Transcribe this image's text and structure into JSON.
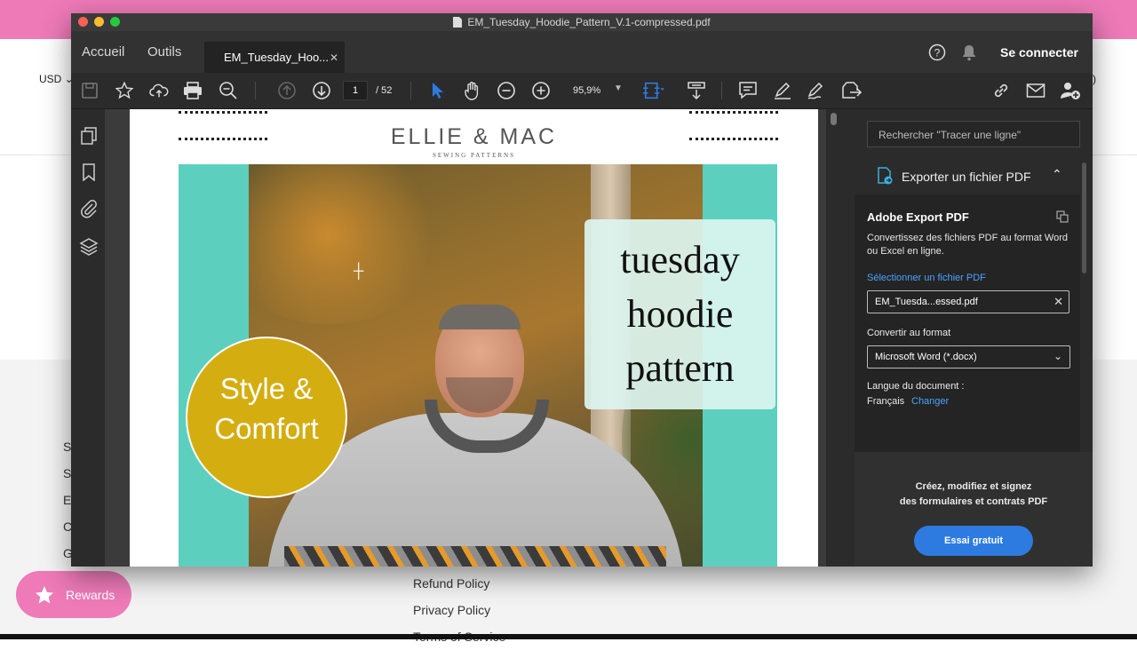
{
  "background": {
    "currency": "USD",
    "footer_links": [
      "Refund Policy",
      "Privacy Policy",
      "Terms of Service"
    ],
    "footer_letters": [
      "S",
      "S",
      "E",
      "C",
      "G"
    ],
    "header_right_fragment": ")",
    "rewards_label": "Rewards"
  },
  "window": {
    "title": "EM_Tuesday_Hoodie_Pattern_V.1-compressed.pdf",
    "tabs": {
      "home": "Accueil",
      "tools": "Outils",
      "doc": "EM_Tuesday_Hoo..."
    },
    "sign_in": "Se connecter"
  },
  "toolbar": {
    "page_current": "1",
    "page_total": "/ 52",
    "zoom": "95,9%"
  },
  "document": {
    "brand": "ELLIE & MAC",
    "brand_sub": "SEWING PATTERNS",
    "title_lines": [
      "tuesday",
      "hoodie",
      "pattern"
    ],
    "badge_lines": [
      "Style &",
      "Comfort"
    ]
  },
  "right_panel": {
    "search_placeholder": "Rechercher \"Tracer une ligne\"",
    "section_title": "Exporter un fichier PDF",
    "export_title": "Adobe Export PDF",
    "export_desc": "Convertissez des fichiers PDF au format Word ou Excel en ligne.",
    "select_file_link": "Sélectionner un fichier PDF",
    "file_name": "EM_Tuesda...essed.pdf",
    "convert_label": "Convertir au format",
    "format_value": "Microsoft Word (*.docx)",
    "lang_label": "Langue du document :",
    "lang_value": "Français",
    "lang_change": "Changer",
    "promo_line1": "Créez, modifiez et signez",
    "promo_line2": "des formulaires et contrats PDF",
    "trial_button": "Essai gratuit"
  },
  "colors": {
    "pink": "#ee7ab8",
    "accent_blue": "#2d7be0",
    "link_blue": "#4aa3ff",
    "teal": "#5ccfbf",
    "mustard": "#d4ad10"
  },
  "icons": [
    "save-icon",
    "star-icon",
    "cloud-upload-icon",
    "print-icon",
    "zoom-search-icon",
    "arrow-up-icon",
    "arrow-down-icon",
    "pointer-icon",
    "hand-icon",
    "minus-circle-icon",
    "plus-circle-icon",
    "fit-icon",
    "scroll-icon",
    "comment-icon",
    "highlight-icon",
    "sign-icon",
    "share-icon",
    "link-icon",
    "mail-icon",
    "add-user-icon",
    "help-icon",
    "bell-icon",
    "pages-icon",
    "bookmark-icon",
    "attachment-icon",
    "layers-icon",
    "export-pdf-icon",
    "chevron-up-icon",
    "chevron-down-icon",
    "close-icon",
    "copy-icon"
  ]
}
